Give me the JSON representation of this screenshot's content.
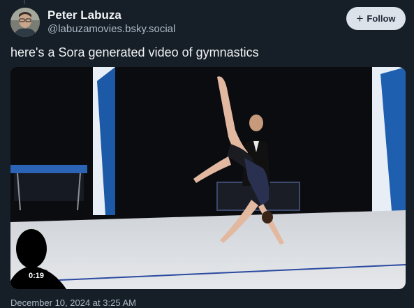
{
  "post": {
    "author_name": "Peter Labuza",
    "author_handle": "@labuzamovies.bsky.social",
    "follow_label": "Follow",
    "text": "here's a Sora generated video of gymnastics",
    "video_duration": "0:19",
    "timestamp": "December 10, 2024 at 3:25 AM"
  },
  "colors": {
    "background": "#161e27",
    "follow_button_bg": "#dce2ea",
    "secondary_text": "#aebbc9"
  },
  "icons": {
    "follow": "plus-icon"
  }
}
